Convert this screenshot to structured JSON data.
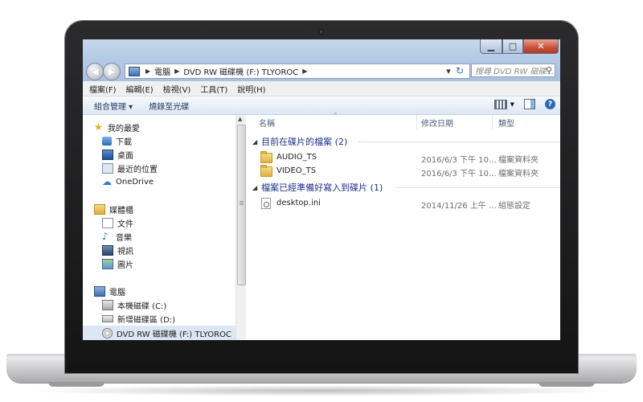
{
  "window": {
    "address": {
      "crumbs": [
        "電腦",
        "DVD RW 磁碟機 (F:) TLYOROC"
      ]
    },
    "search_placeholder": "搜尋 DVD RW 磁碟...",
    "menu": [
      "檔案(F)",
      "編輯(E)",
      "檢視(V)",
      "工具(T)",
      "說明(H)"
    ],
    "toolbar": {
      "organize": "組合管理 ▾",
      "burn": "燒錄至光碟"
    }
  },
  "navpane": {
    "favorites": {
      "label": "我的最愛",
      "items": [
        "下載",
        "桌面",
        "最近的位置",
        "OneDrive"
      ]
    },
    "libraries": {
      "label": "媒體櫃",
      "items": [
        "文件",
        "音樂",
        "視訊",
        "圖片"
      ]
    },
    "computer": {
      "label": "電腦",
      "items": [
        "本機磁碟 (C:)",
        "新增磁碟區 (D:)",
        "DVD RW 磁碟機 (F:) TLYOROC"
      ]
    }
  },
  "columns": {
    "name": "名稱",
    "modified": "修改日期",
    "type": "類型"
  },
  "groups": [
    {
      "label": "目前在碟片的檔案 (2)",
      "files": [
        {
          "name": "AUDIO_TS",
          "date": "2016/6/3 下午 10...",
          "type": "檔案資料夾",
          "icon": "folder-icon"
        },
        {
          "name": "VIDEO_TS",
          "date": "2016/6/3 下午 10...",
          "type": "檔案資料夾",
          "icon": "folder-icon"
        }
      ]
    },
    {
      "label": "檔案已經準備好寫入到碟片 (1)",
      "files": [
        {
          "name": "desktop.ini",
          "date": "2014/11/26 上午 ...",
          "type": "組態設定",
          "icon": "config-file-icon"
        }
      ]
    }
  ],
  "colors": {
    "chrome": "#b9cde6",
    "group_text": "#1e3287",
    "selection": "#dce6f4"
  }
}
